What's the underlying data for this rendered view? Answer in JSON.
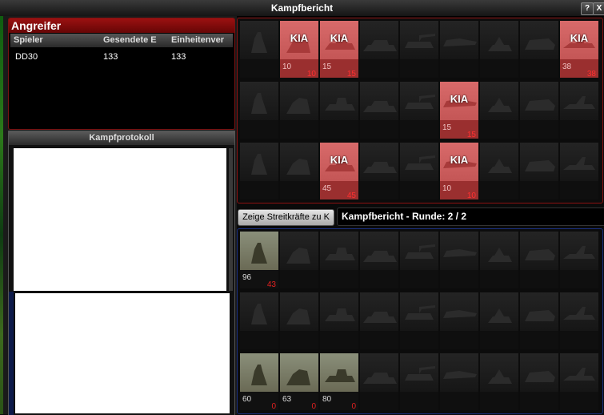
{
  "window": {
    "title": "Kampfbericht",
    "help_label": "?",
    "close_label": "X"
  },
  "attacker": {
    "title": "Angreifer",
    "columns": [
      "Spieler",
      "Gesendete E",
      "Einheitenver"
    ],
    "rows": [
      {
        "player": "DD30",
        "sent": "133",
        "lost": "133"
      }
    ]
  },
  "log": {
    "title": "Kampfprotokoll"
  },
  "controls": {
    "show_forces_label": "Zeige Streitkräfte zu K",
    "round_label": "Kampfbericht - Runde: 2 / 2"
  },
  "enemy_grid": {
    "kia_label": "KIA",
    "cells": [
      {
        "row": 0,
        "col": 1,
        "count": "10",
        "lost": "10"
      },
      {
        "row": 0,
        "col": 2,
        "count": "15",
        "lost": "15"
      },
      {
        "row": 0,
        "col": 8,
        "count": "38",
        "lost": "38"
      },
      {
        "row": 1,
        "col": 5,
        "count": "15",
        "lost": "15"
      },
      {
        "row": 2,
        "col": 2,
        "count": "45",
        "lost": "45"
      },
      {
        "row": 2,
        "col": 5,
        "count": "10",
        "lost": "10"
      }
    ]
  },
  "own_grid": {
    "cells": [
      {
        "row": 0,
        "col": 0,
        "count": "96",
        "lost": "43",
        "icon": "rifleman-unit-icon"
      },
      {
        "row": 2,
        "col": 0,
        "count": "60",
        "lost": "0",
        "icon": "sniper-unit-icon"
      },
      {
        "row": 2,
        "col": 1,
        "count": "63",
        "lost": "0",
        "icon": "crouching-soldier-unit-icon"
      },
      {
        "row": 2,
        "col": 2,
        "count": "80",
        "lost": "0",
        "icon": "rocket-soldier-unit-icon"
      }
    ]
  }
}
